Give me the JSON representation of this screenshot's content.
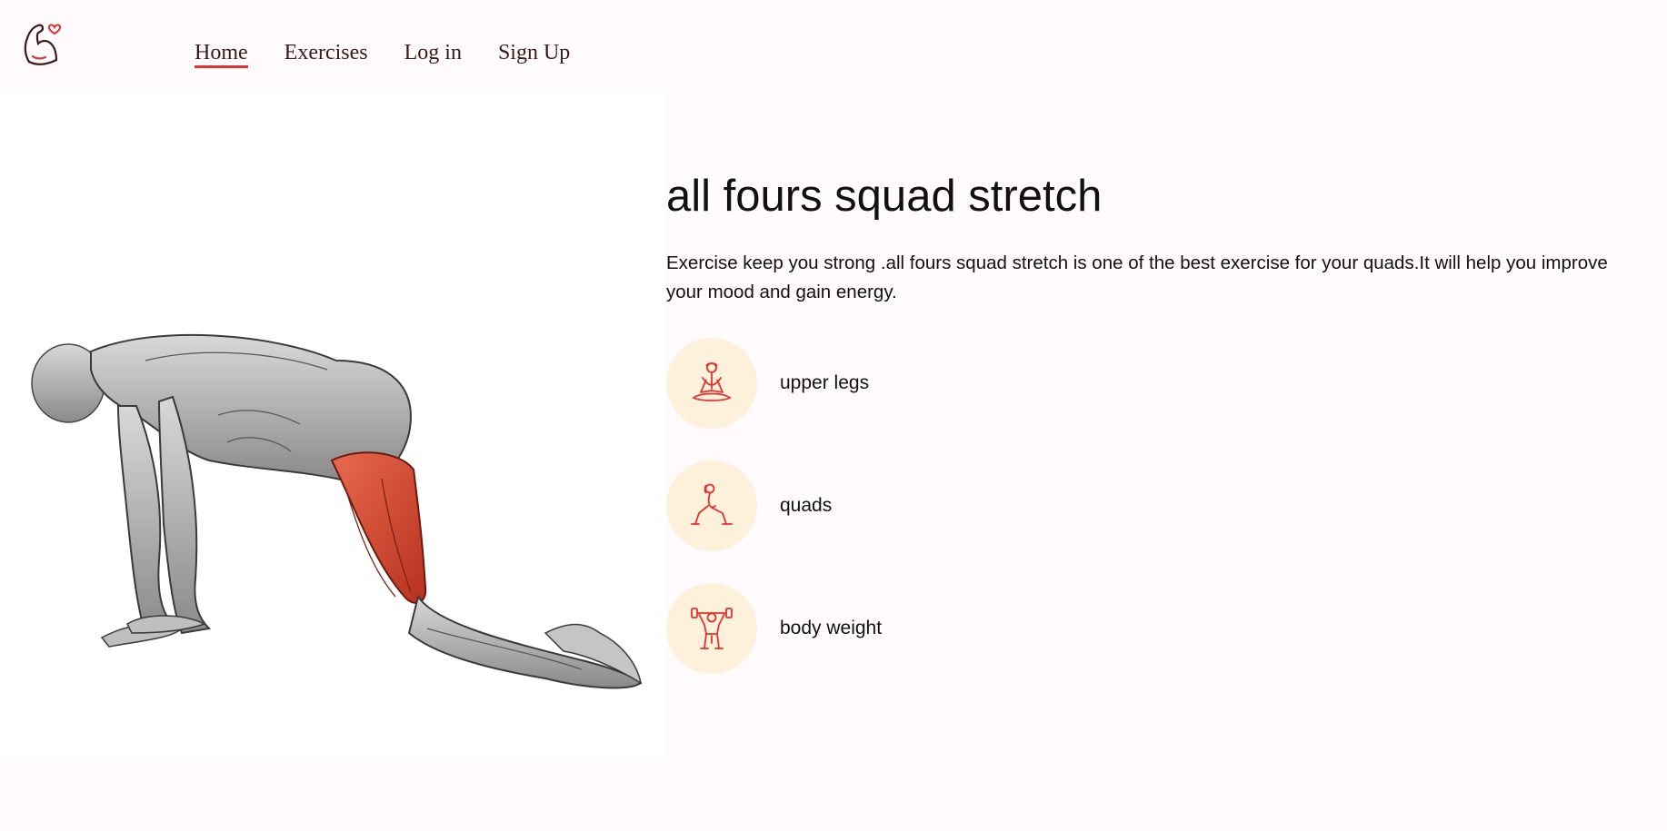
{
  "nav": {
    "links": [
      {
        "label": "Home",
        "active": true
      },
      {
        "label": "Exercises",
        "active": false
      },
      {
        "label": "Log in",
        "active": false
      },
      {
        "label": "Sign Up",
        "active": false
      }
    ],
    "logo_icon": "flexed-arm-heart-icon"
  },
  "exercise": {
    "name": "all fours squad stretch",
    "description": "Exercise keep you strong .all fours squad stretch is one of the best exercise for your quads.It will help you improve your mood and gain energy.",
    "tags": [
      {
        "label": "upper legs",
        "icon": "meditation-pose-icon"
      },
      {
        "label": "quads",
        "icon": "lunge-pose-icon"
      },
      {
        "label": "body weight",
        "icon": "dumbbell-lift-icon"
      }
    ]
  },
  "colors": {
    "accent": "#e0342f",
    "background": "#fffafb",
    "tag_circle": "#fdf1dc",
    "muscle_highlight": "#d9472f"
  }
}
